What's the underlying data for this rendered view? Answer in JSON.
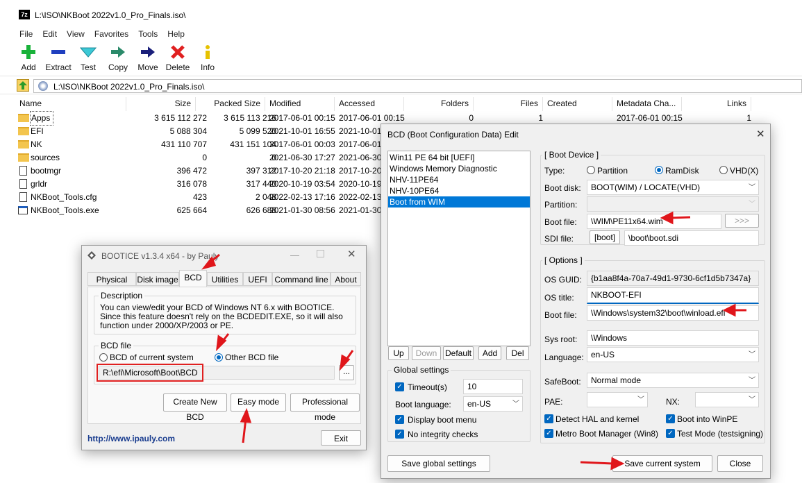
{
  "zip": {
    "title": "L:\\ISO\\NKBoot 2022v1.0_Pro_Finals.iso\\",
    "menu": [
      "File",
      "Edit",
      "View",
      "Favorites",
      "Tools",
      "Help"
    ],
    "toolbar": [
      "Add",
      "Extract",
      "Test",
      "Copy",
      "Move",
      "Delete",
      "Info"
    ],
    "address": "L:\\ISO\\NKBoot 2022v1.0_Pro_Finals.iso\\",
    "columns": [
      "Name",
      "Size",
      "Packed Size",
      "Modified",
      "Accessed",
      "Folders",
      "Files",
      "Created",
      "Metadata Cha...",
      "Links"
    ],
    "rows": [
      {
        "name": "Apps",
        "size": "3 615 112 272",
        "packed": "3 615 113 216",
        "modified": "2017-06-01 00:15",
        "accessed": "2017-06-01 00:15",
        "folders": "0",
        "files": "1",
        "meta": "2017-06-01 00:15",
        "links": "1",
        "type": "folder"
      },
      {
        "name": "EFI",
        "size": "5 088 304",
        "packed": "5 099 520",
        "modified": "2021-10-01 16:55",
        "accessed": "2021-10-01",
        "type": "folder"
      },
      {
        "name": "NK",
        "size": "431 110 707",
        "packed": "431 151 104",
        "modified": "2017-06-01 00:03",
        "accessed": "2017-06-01",
        "type": "folder"
      },
      {
        "name": "sources",
        "size": "0",
        "packed": "0",
        "modified": "2021-06-30 17:27",
        "accessed": "2021-06-30",
        "type": "folder"
      },
      {
        "name": "bootmgr",
        "size": "396 472",
        "packed": "397 312",
        "modified": "2017-10-20 21:18",
        "accessed": "2017-10-20",
        "type": "file"
      },
      {
        "name": "grldr",
        "size": "316 078",
        "packed": "317 440",
        "modified": "2020-10-19 03:54",
        "accessed": "2020-10-19",
        "type": "file"
      },
      {
        "name": "NKBoot_Tools.cfg",
        "size": "423",
        "packed": "2 048",
        "modified": "2022-02-13 17:16",
        "accessed": "2022-02-13",
        "type": "file"
      },
      {
        "name": "NKBoot_Tools.exe",
        "size": "625 664",
        "packed": "626 688",
        "modified": "2021-01-30 08:56",
        "accessed": "2021-01-30",
        "type": "exe"
      }
    ]
  },
  "bootice": {
    "title": "BOOTICE v1.3.4 x64 - by Pauly",
    "tabs": [
      "Physical disk",
      "Disk image",
      "BCD",
      "Utilities",
      "UEFI",
      "Command line",
      "About"
    ],
    "description_title": "Description",
    "description": "You can view/edit your BCD of Windows NT 6.x with BOOTICE. Since this feature doesn't rely on the BCDEDIT.EXE, so it will also function under 2000/XP/2003 or PE.",
    "bcd_file_title": "BCD file",
    "radio_current": "BCD of current system",
    "radio_other": "Other BCD file",
    "path": "R:\\efi\\Microsoft\\Boot\\BCD",
    "browse": "...",
    "btn_create": "Create New BCD",
    "btn_easy": "Easy mode",
    "btn_pro": "Professional mode",
    "link": "http://www.ipauly.com",
    "btn_exit": "Exit"
  },
  "bcd": {
    "title": "BCD (Boot Configuration Data) Edit",
    "entries": [
      "Win11 PE 64 bit [UEFI]",
      "Windows Memory Diagnostic",
      "NHV-11PE64",
      "NHV-10PE64",
      "Boot from WIM"
    ],
    "list_buttons": [
      "Up",
      "Down",
      "Default",
      "Add",
      "Del"
    ],
    "global_title": "Global settings",
    "timeout_label": "Timeout(s)",
    "timeout": "10",
    "boot_language_label": "Boot language:",
    "boot_language": "en-US",
    "display_menu": "Display boot menu",
    "no_integrity": "No integrity checks",
    "save_global": "Save global settings",
    "boot_device_title": "[ Boot Device ]",
    "type_label": "Type:",
    "type_options": [
      "Partition",
      "RamDisk",
      "VHD(X)"
    ],
    "boot_disk_label": "Boot disk:",
    "boot_disk": "BOOT(WIM) / LOCATE(VHD)",
    "partition_label": "Partition:",
    "boot_file_label": "Boot file:",
    "boot_file": "\\WIM\\PE11x64.wim",
    "more": ">>>",
    "sdi_label": "SDI file:",
    "sdi_boot": "[boot]",
    "sdi_file": "\\boot\\boot.sdi",
    "options_title": "[ Options ]",
    "os_guid_label": "OS GUID:",
    "os_guid": "{b1aa8f4a-70a7-49d1-9730-6cf1d5b7347a}",
    "os_title_label": "OS title:",
    "os_title": "NKBOOT-EFI",
    "boot_file2_label": "Boot file:",
    "boot_file2": "\\Windows\\system32\\boot\\winload.efi",
    "sys_root_label": "Sys root:",
    "sys_root": "\\Windows",
    "language_label": "Language:",
    "language": "en-US",
    "safeboot_label": "SafeBoot:",
    "safeboot": "Normal mode",
    "pae_label": "PAE:",
    "nx_label": "NX:",
    "detect_hal": "Detect HAL and kernel",
    "boot_winpe": "Boot into WinPE",
    "metro": "Metro Boot Manager (Win8)",
    "test_mode": "Test Mode (testsigning)",
    "save_current": "Save current system",
    "close": "Close"
  }
}
